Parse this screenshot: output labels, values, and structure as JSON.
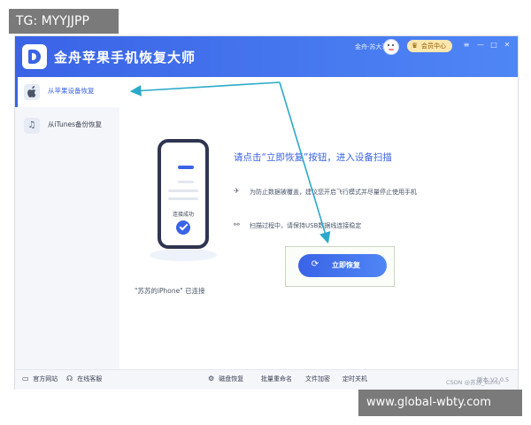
{
  "app": {
    "title": "金舟苹果手机恢复大师",
    "username": "金舟-苏大哥",
    "vip_label": "会员中心",
    "window_controls": [
      "≡",
      "—",
      "□",
      "✕"
    ]
  },
  "sidebar": {
    "items": [
      {
        "label": "从苹果设备恢复",
        "icon": "apple-icon",
        "active": true
      },
      {
        "label": "从iTunes备份恢复",
        "icon": "music-note-icon",
        "active": false
      }
    ]
  },
  "device": {
    "status": "连接成功",
    "caption": "\"苏苏的iPhone\" 已连接"
  },
  "main": {
    "prompt": "请点击“立即恢复”按钮，进入设备扫描",
    "tips": [
      {
        "icon": "airplane-icon",
        "text": "为防止数据被覆盖，建议您开启飞行模式并尽量停止使用手机"
      },
      {
        "icon": "usb-icon",
        "text": "扫描过程中，请保持USB数据线连接稳定"
      }
    ],
    "restore_button": "立即恢复"
  },
  "footer": {
    "items": [
      {
        "label": "官方网站",
        "icon": "monitor-icon"
      },
      {
        "label": "在线客服",
        "icon": "headset-icon"
      },
      {
        "label": "磁盘恢复",
        "icon": "disk-recovery-icon"
      },
      {
        "label": "批量重命名",
        "icon": ""
      },
      {
        "label": "文件加密",
        "icon": ""
      },
      {
        "label": "定时关机",
        "icon": ""
      }
    ],
    "version": "版本:V2.0.5"
  },
  "overlays": {
    "tg_badge": "TG: MYYJJPP",
    "csdn": "CSDN @苏苏_sumu",
    "watermark": "www.global-wbty.com"
  },
  "colors": {
    "accent": "#3a63e6",
    "annotation_arrow": "#2aa9c9",
    "vip_bg": "#ffe7ad"
  }
}
